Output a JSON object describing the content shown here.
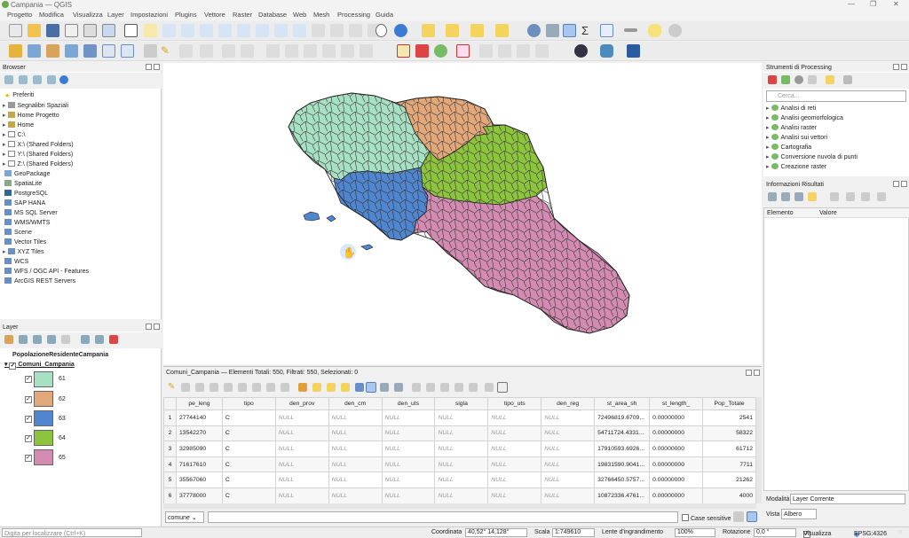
{
  "window": {
    "title": "Campania — QGIS"
  },
  "menu": [
    "Progetto",
    "Modifica",
    "Visualizza",
    "Layer",
    "Impostazioni",
    "Plugins",
    "Vettore",
    "Raster",
    "Database",
    "Web",
    "Mesh",
    "Processing",
    "Guida"
  ],
  "browser": {
    "title": "Browser",
    "items": [
      "Preferiti",
      "Segnalibri Spaziali",
      "Home Progetto",
      "Home",
      "C:\\",
      "X:\\ (Shared Folders)",
      "Y:\\ (Shared Folders)",
      "Z:\\ (Shared Folders)",
      "GeoPackage",
      "SpatiaLite",
      "PostgreSQL",
      "SAP HANA",
      "MS SQL Server",
      "WMS/WMTS",
      "Scene",
      "Vector Tiles",
      "XYZ Tiles",
      "WCS",
      "WFS / OGC API - Features",
      "ArcGIS REST Servers"
    ]
  },
  "layers": {
    "title": "Layer",
    "group": "PopolazioneResidenteCampania",
    "layer": "Comuni_Campania",
    "classes": [
      {
        "label": "61",
        "color": "#a8e0c4"
      },
      {
        "label": "62",
        "color": "#e3a87a"
      },
      {
        "label": "63",
        "color": "#4f86cf"
      },
      {
        "label": "64",
        "color": "#8dc43d"
      },
      {
        "label": "65",
        "color": "#d48bb2"
      }
    ]
  },
  "processing": {
    "title": "Strumenti di Processing",
    "search_placeholder": "Cerca...",
    "items": [
      "Analisi di reti",
      "Analisi geomorfologica",
      "Analisi raster",
      "Analisi sui vettori",
      "Cartografia",
      "Conversione nuvola di punti",
      "Creazione raster"
    ]
  },
  "results": {
    "title": "Informazioni Risultati",
    "col_element": "Elemento",
    "col_value": "Valore",
    "mode_label": "Modalità",
    "mode_value": "Layer Corrente",
    "view_label": "Vista",
    "view_value": "Albero"
  },
  "attr": {
    "title": "Comuni_Campania — Elementi Totali: 550,  Filtrati: 550, Selezionati: 0",
    "columns": [
      "pe_leng",
      "tipo",
      "den_prov",
      "den_cm",
      "den_uts",
      "sigla",
      "tipo_uts",
      "den_reg",
      "st_area_sh",
      "st_length_",
      "Pop_Totale"
    ],
    "rows": [
      [
        "1",
        "27744140",
        "C",
        "NULL",
        "NULL",
        "NULL",
        "NULL",
        "NULL",
        "NULL",
        "72496819.6709...",
        "0.00000000",
        "2541"
      ],
      [
        "2",
        "13542270",
        "C",
        "NULL",
        "NULL",
        "NULL",
        "NULL",
        "NULL",
        "NULL",
        "54711724.4331...",
        "0.00000000",
        "58322"
      ],
      [
        "3",
        "32985090",
        "C",
        "NULL",
        "NULL",
        "NULL",
        "NULL",
        "NULL",
        "NULL",
        "17910593.6926...",
        "0.00000000",
        "61712"
      ],
      [
        "4",
        "71617610",
        "C",
        "NULL",
        "NULL",
        "NULL",
        "NULL",
        "NULL",
        "NULL",
        "19831590.9041...",
        "0.00000000",
        "7711"
      ],
      [
        "5",
        "35567060",
        "C",
        "NULL",
        "NULL",
        "NULL",
        "NULL",
        "NULL",
        "NULL",
        "32766450.5757...",
        "0.00000000",
        "21262"
      ],
      [
        "6",
        "37778000",
        "C",
        "NULL",
        "NULL",
        "NULL",
        "NULL",
        "NULL",
        "NULL",
        "10872336.4761...",
        "0.00000000",
        "4000"
      ]
    ],
    "filter_field": "comune",
    "case_label": "Case sensitive"
  },
  "status": {
    "search_placeholder": "Digita per localizzare (Ctrl+K)",
    "coord_label": "Coordinata",
    "coord_value": "40,52° 14,128°",
    "scale_label": "Scala",
    "scale_value": "1:749610",
    "mag_label": "Lente d'ingrandimento",
    "mag_value": "100%",
    "rot_label": "Rotazione",
    "rot_value": "0,0 °",
    "render_label": "Visualizza",
    "crs": "EPSG:4326"
  }
}
